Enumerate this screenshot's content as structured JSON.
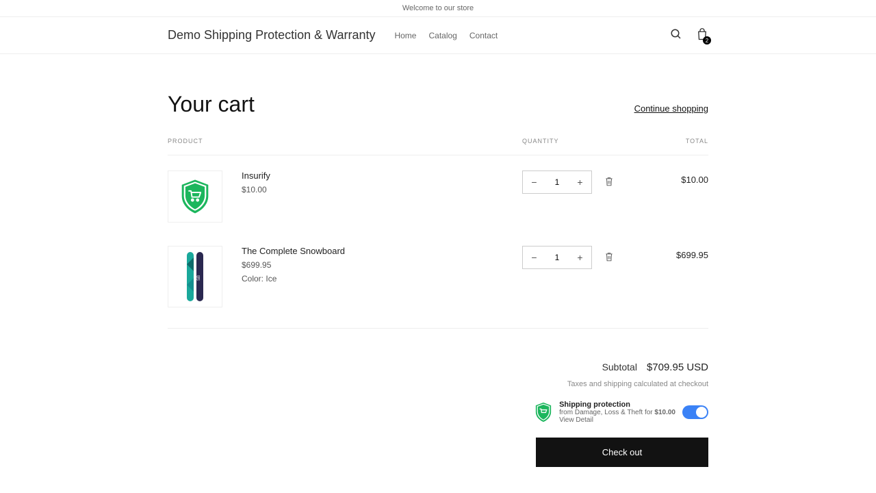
{
  "announcement": "Welcome to our store",
  "brand": "Demo Shipping Protection & Warranty",
  "nav": {
    "home": "Home",
    "catalog": "Catalog",
    "contact": "Contact"
  },
  "cart_badge": "2",
  "cart": {
    "title": "Your cart",
    "continue": "Continue shopping",
    "headers": {
      "product": "PRODUCT",
      "quantity": "QUANTITY",
      "total": "TOTAL"
    },
    "items": [
      {
        "name": "Insurify",
        "price": "$10.00",
        "variant_label": "",
        "variant_value": "",
        "qty": "1",
        "total": "$10.00"
      },
      {
        "name": "The Complete Snowboard",
        "price": "$699.95",
        "variant_label": "Color:",
        "variant_value": "Ice",
        "qty": "1",
        "total": "$699.95"
      }
    ],
    "subtotal_label": "Subtotal",
    "subtotal": "$709.95 USD",
    "tax_note": "Taxes and shipping calculated at checkout",
    "protection": {
      "title": "Shipping protection",
      "desc_prefix": "from Damage, Loss & Theft for ",
      "desc_amount": "$10.00",
      "view": "View Detail"
    },
    "checkout": "Check out"
  }
}
